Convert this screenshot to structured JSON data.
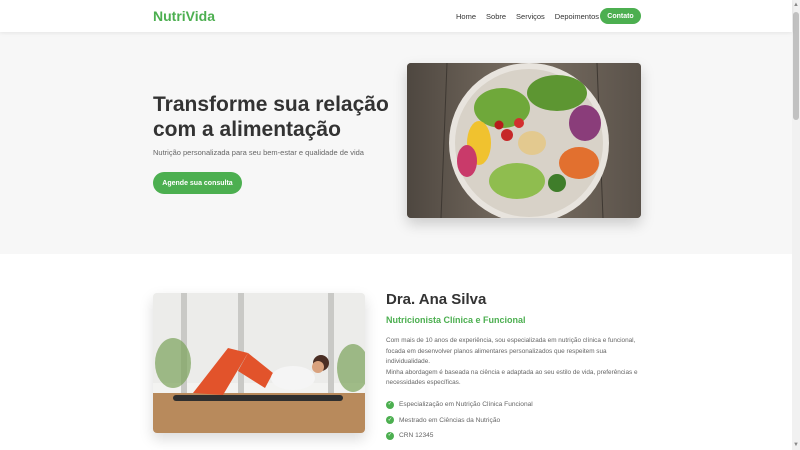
{
  "header": {
    "logo": "NutriVida",
    "nav": [
      "Home",
      "Sobre",
      "Serviços",
      "Depoimentos"
    ],
    "contact": "Contato"
  },
  "hero": {
    "title": "Transforme sua relação com a alimentação",
    "subtitle": "Nutrição personalizada para seu bem-estar e qualidade de vida",
    "cta": "Agende sua consulta"
  },
  "about": {
    "name": "Dra. Ana Silva",
    "role": "Nutricionista Clínica e Funcional",
    "paragraph1": "Com mais de 10 anos de experiência, sou especializada em nutrição clínica e funcional, focada em desenvolver planos alimentares personalizados que respeitem sua individualidade.",
    "paragraph2": "Minha abordagem é baseada na ciência e adaptada ao seu estilo de vida, preferências e necessidades específicas.",
    "credentials": [
      "Especialização em Nutrição Clínica Funcional",
      "Mestrado em Ciências da Nutrição",
      "CRN 12345"
    ]
  },
  "colors": {
    "accent": "#4caf50",
    "hero_bg": "#f7f7f7",
    "text": "#333333"
  },
  "icons": {
    "check": "check-circle-icon"
  }
}
